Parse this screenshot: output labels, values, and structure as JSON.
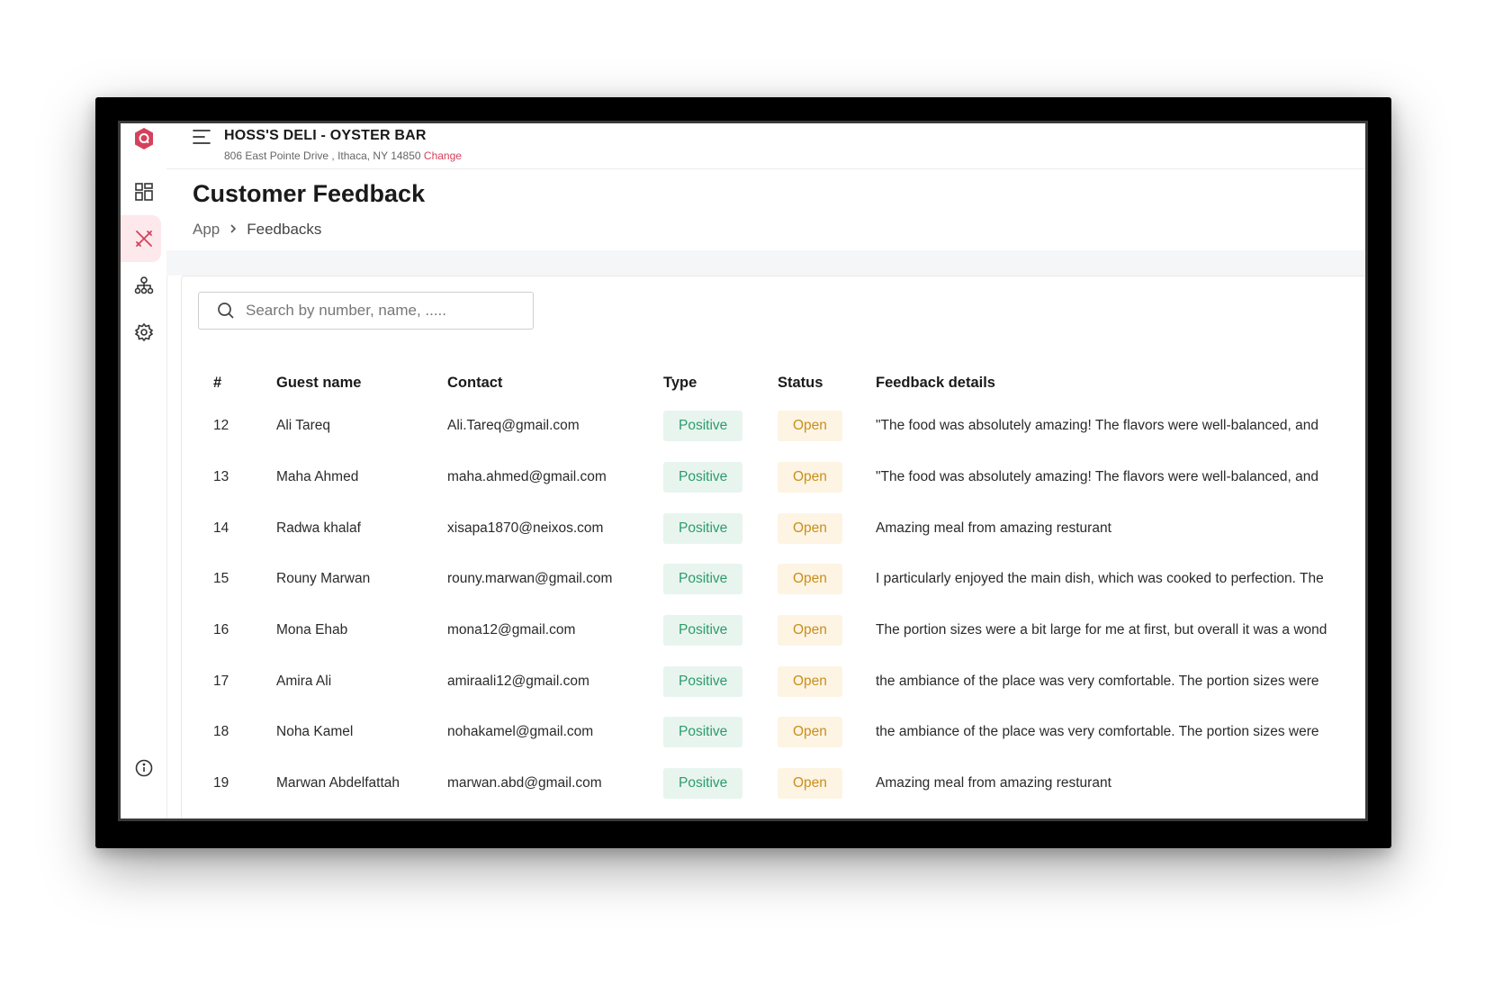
{
  "restaurant": {
    "name": "HOSS'S DELI - OYSTER BAR",
    "address": "806 East Pointe Drive , Ithaca, NY 14850",
    "change_label": "Change"
  },
  "page": {
    "title": "Customer Feedback",
    "breadcrumb": [
      "App",
      "Feedbacks"
    ]
  },
  "search": {
    "placeholder": "Search by number, name, ....."
  },
  "table": {
    "headers": [
      "#",
      "Guest name",
      "Contact",
      "Type",
      "Status",
      "Feedback details"
    ],
    "rows": [
      {
        "num": "12",
        "name": "Ali Tareq",
        "contact": "Ali.Tareq@gmail.com",
        "type": "Positive",
        "status": "Open",
        "feedback": "\"The food was absolutely amazing! The flavors were well-balanced, and"
      },
      {
        "num": "13",
        "name": "Maha Ahmed",
        "contact": "maha.ahmed@gmail.com",
        "type": "Positive",
        "status": "Open",
        "feedback": "\"The food was absolutely amazing! The flavors were well-balanced, and"
      },
      {
        "num": "14",
        "name": "Radwa khalaf",
        "contact": "xisapa1870@neixos.com",
        "type": "Positive",
        "status": "Open",
        "feedback": "Amazing meal from amazing resturant"
      },
      {
        "num": "15",
        "name": "Rouny Marwan",
        "contact": "rouny.marwan@gmail.com",
        "type": "Positive",
        "status": "Open",
        "feedback": "I particularly enjoyed the main dish, which was cooked to perfection. The"
      },
      {
        "num": "16",
        "name": "Mona Ehab",
        "contact": "mona12@gmail.com",
        "type": "Positive",
        "status": "Open",
        "feedback": "The portion sizes were a bit large for me at first, but overall it was a wond"
      },
      {
        "num": "17",
        "name": "Amira Ali",
        "contact": "amiraali12@gmail.com",
        "type": "Positive",
        "status": "Open",
        "feedback": "the ambiance of the place was very comfortable. The portion sizes were"
      },
      {
        "num": "18",
        "name": "Noha Kamel",
        "contact": "nohakamel@gmail.com",
        "type": "Positive",
        "status": "Open",
        "feedback": "the ambiance of the place was very comfortable. The portion sizes were"
      },
      {
        "num": "19",
        "name": "Marwan Abdelfattah",
        "contact": "marwan.abd@gmail.com",
        "type": "Positive",
        "status": "Open",
        "feedback": "Amazing meal from amazing resturant"
      }
    ]
  },
  "sidebar": {
    "items": [
      {
        "icon": "dashboard-icon"
      },
      {
        "icon": "utensils-icon",
        "active": true
      },
      {
        "icon": "org-chart-icon"
      },
      {
        "icon": "gear-icon"
      }
    ],
    "footer_icon": "info-icon"
  },
  "colors": {
    "accent": "#d6405a",
    "positive_bg": "#e8f5ef",
    "positive_text": "#2d9b6a",
    "open_bg": "#fdf4e3",
    "open_text": "#c98f1e"
  }
}
